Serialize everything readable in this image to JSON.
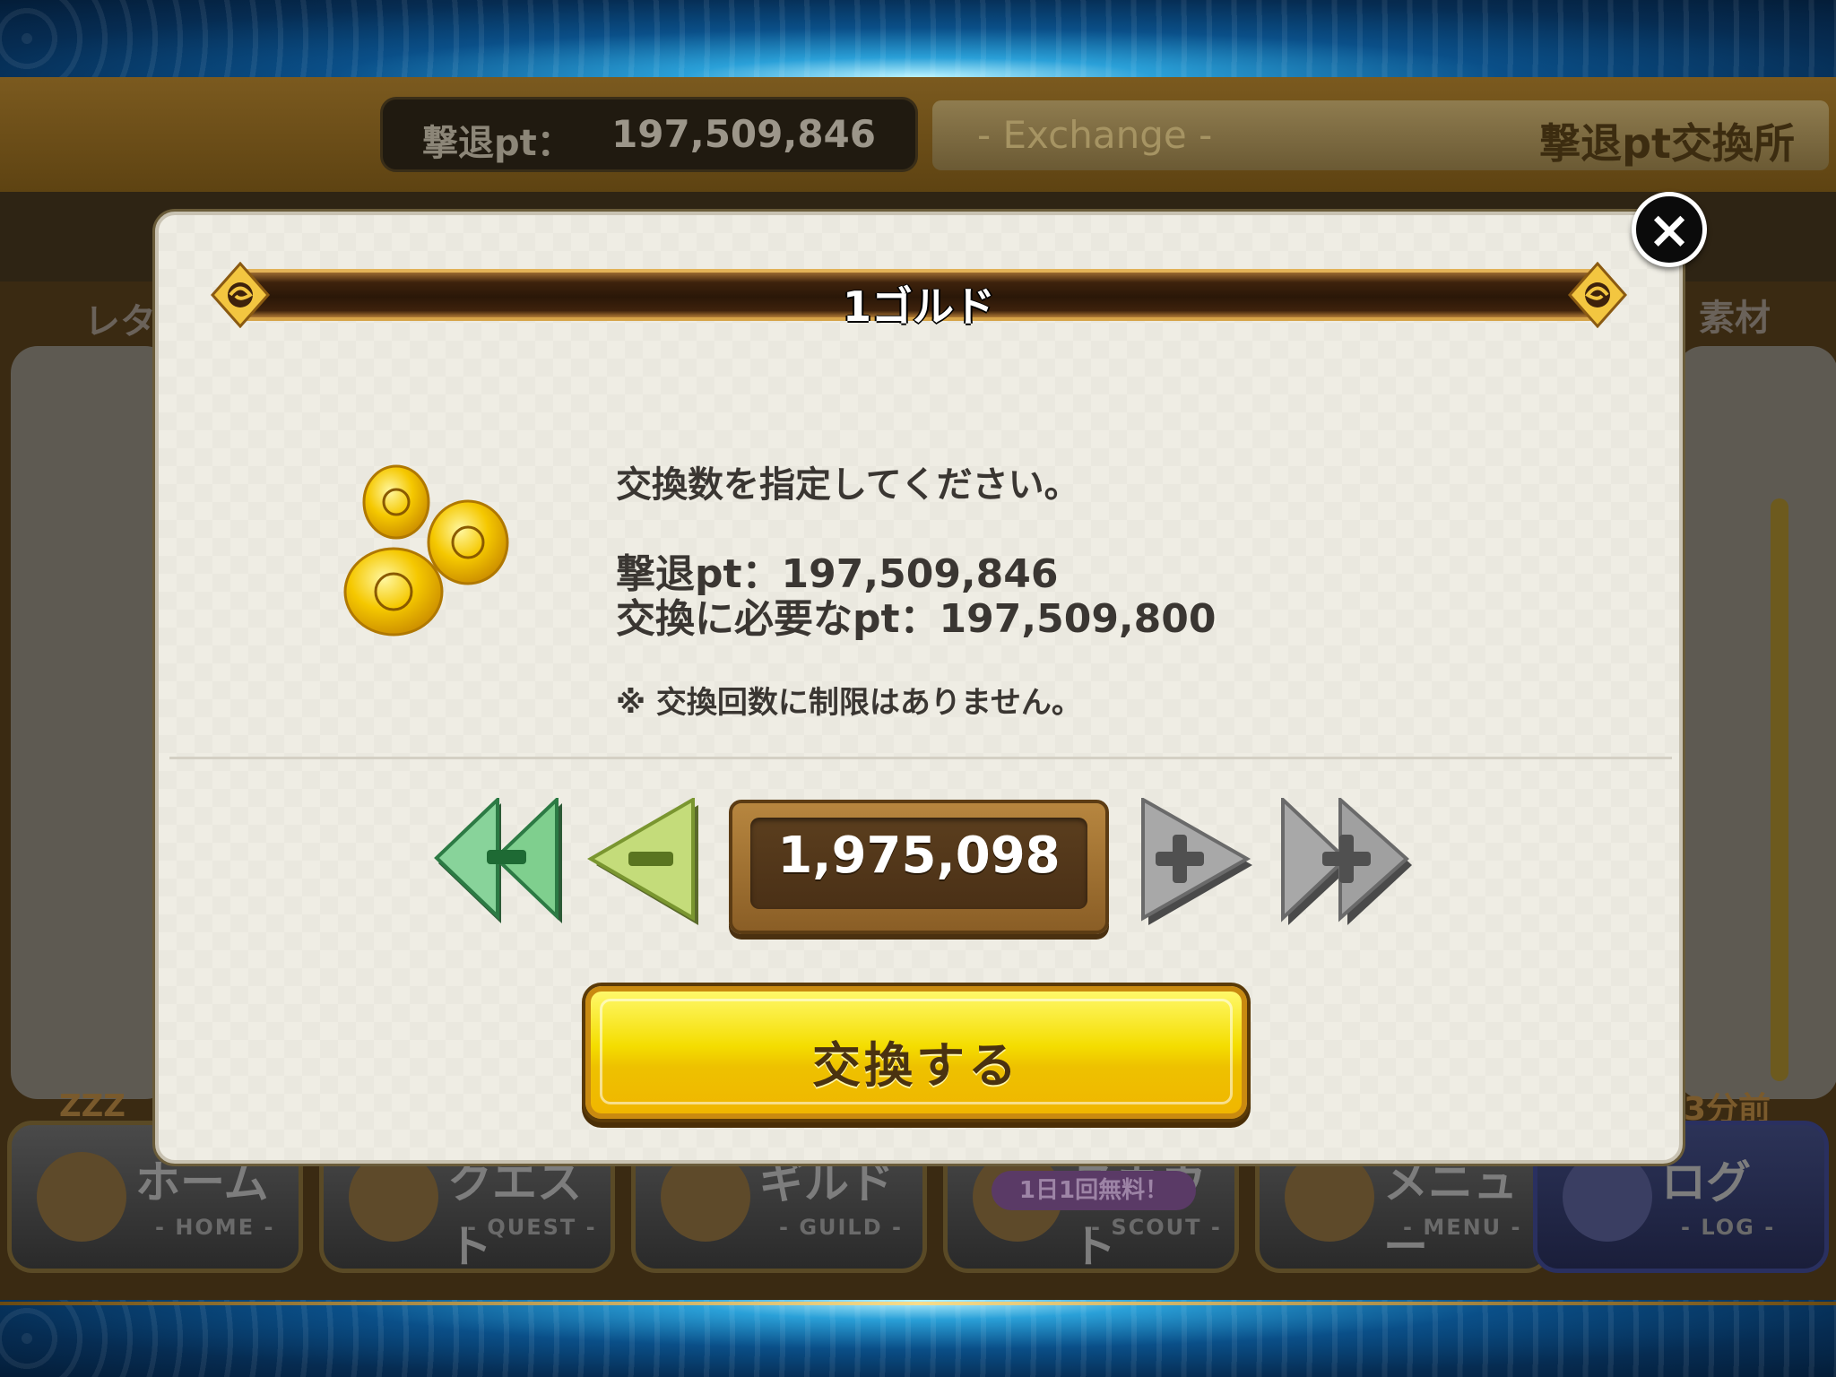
{
  "header": {
    "pt_label": "撃退pt：",
    "pt_value": "197,509,846",
    "exchange_sub": "- Exchange -",
    "exchange_title": "撃退pt交換所"
  },
  "background": {
    "left_label": "レタ",
    "right_label": "素材",
    "zzz": "ZZZ",
    "ago": "3分前"
  },
  "dialog": {
    "title": "1ゴルド",
    "close_label": "×",
    "instruction": "交換数を指定してください。",
    "current_pt": "撃退pt：197,509,846",
    "required_pt": "交換に必要なpt：197,509,800",
    "note": "※ 交換回数に制限はありません。",
    "quantity": "1,975,098",
    "exchange_button": "交換する",
    "item_icon": "gold-coins-icon"
  },
  "nav": {
    "items": [
      {
        "jp": "ホーム",
        "en": "- HOME -"
      },
      {
        "jp": "クエスト",
        "en": "- QUEST -"
      },
      {
        "jp": "ギルド",
        "en": "- GUILD -"
      },
      {
        "jp": "スカウト",
        "en": "- SCOUT -"
      },
      {
        "jp": "メニュー",
        "en": "- MENU -"
      },
      {
        "jp": "ログ",
        "en": "- LOG -"
      }
    ],
    "scout_badge": "1日1回無料！"
  },
  "colors": {
    "accent_gold": "#f4dd00",
    "title_bar": "#2a1708",
    "dialog_bg": "#efede4",
    "minus_max": "#7fcf8e",
    "minus_one": "#c4dc7a",
    "plus_disabled": "#a0a0a0"
  }
}
